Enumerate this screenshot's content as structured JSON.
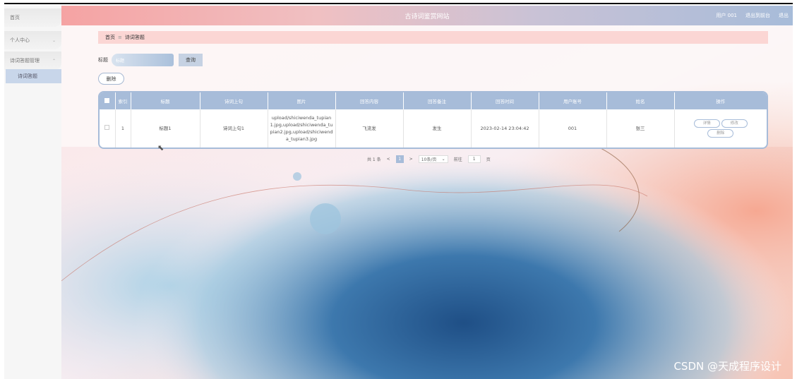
{
  "sidebar": {
    "items": [
      {
        "label": "首页"
      },
      {
        "label": "个人中心"
      },
      {
        "label": "诗词答题管理"
      }
    ],
    "sub_item": "诗词答题"
  },
  "header": {
    "title": "古诗词鉴赏网站",
    "user": "用户 001",
    "back_label": "退出到前台",
    "logout_label": "退出"
  },
  "breadcrumb": {
    "home": "首页",
    "separator": "≡",
    "current": "诗词答题"
  },
  "search": {
    "label": "标题",
    "placeholder": "标题",
    "button": "查询"
  },
  "delete_button": "删除",
  "table": {
    "columns": [
      "索引",
      "标题",
      "诗词上句",
      "图片",
      "回答内容",
      "回答备注",
      "回答时间",
      "用户账号",
      "姓名",
      "操作"
    ],
    "rows": [
      {
        "index": "1",
        "title": "标题1",
        "first_line": "诗词上句1",
        "image": "upload/shiciwenda_tupian1.jpg,upload/shiciwenda_tupian2.jpg,upload/shiciwenda_tupian3.jpg",
        "answer": "飞流发",
        "note": "发生",
        "time": "2023-02-14 23:04:42",
        "account": "001",
        "name": "张三",
        "actions": {
          "detail": "详情",
          "edit": "修改",
          "delete": "删除"
        }
      }
    ]
  },
  "pager": {
    "total": "共 1 条",
    "prev": "<",
    "page": "1",
    "next": ">",
    "page_size": "10条/页",
    "goto": "前往",
    "goto_value": "1",
    "page_unit": "页"
  },
  "watermark": "CSDN @天成程序设计",
  "colors": {
    "accent": "#a7bcd9",
    "header_left": "#f5a3a3",
    "breadcrumb_bg": "#fbd6d4"
  }
}
